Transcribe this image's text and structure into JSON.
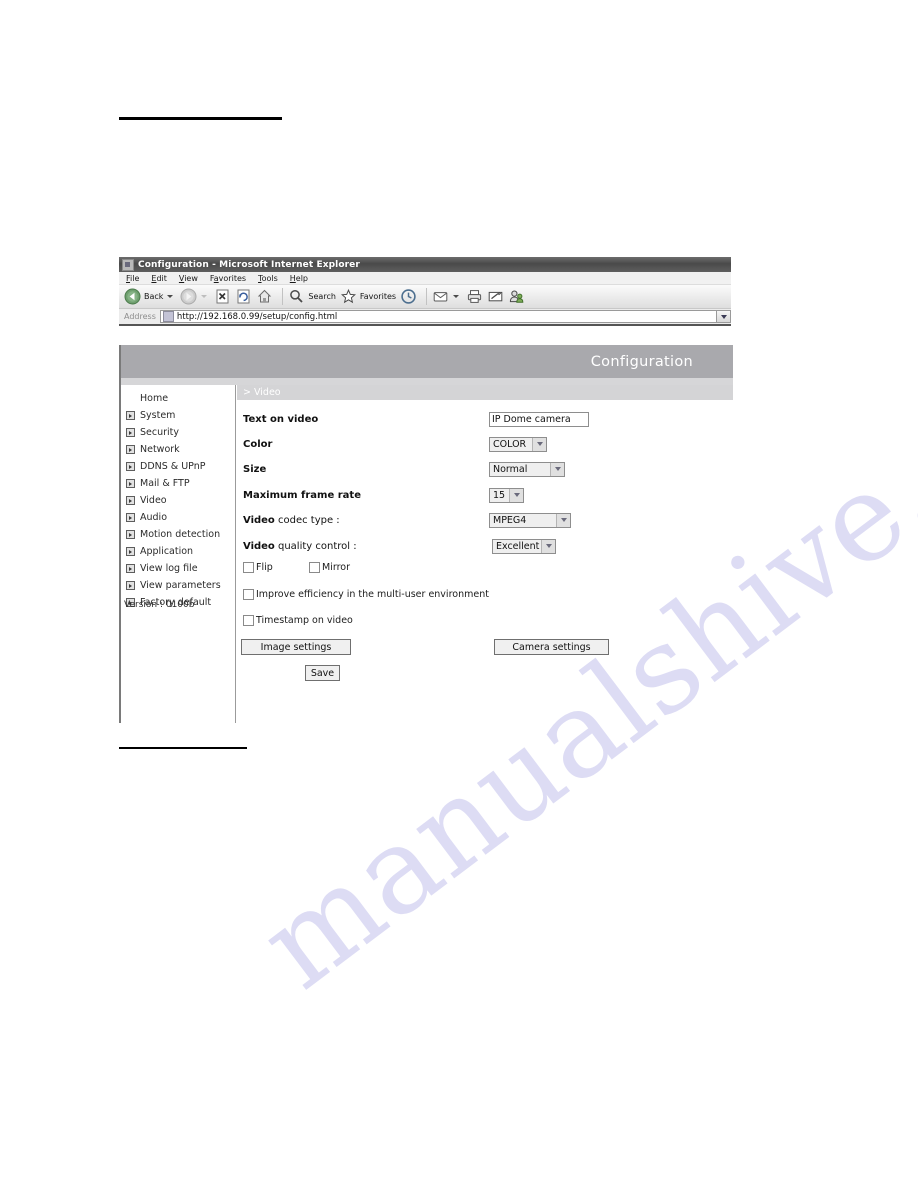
{
  "browser": {
    "title": "Configuration - Microsoft Internet Explorer",
    "menu": [
      {
        "pre": "",
        "acc": "F",
        "post": "ile"
      },
      {
        "pre": "",
        "acc": "E",
        "post": "dit"
      },
      {
        "pre": "",
        "acc": "V",
        "post": "iew"
      },
      {
        "pre": "F",
        "acc": "a",
        "post": "vorites"
      },
      {
        "pre": "",
        "acc": "T",
        "post": "ools"
      },
      {
        "pre": "",
        "acc": "H",
        "post": "elp"
      }
    ],
    "toolbar": {
      "back_label": "Back",
      "forward_label": "",
      "stop_name": "stop-icon",
      "refresh_name": "refresh-icon",
      "home_name": "home-icon",
      "search_label": "Search",
      "favorites_label": "Favorites",
      "history_name": "history-icon",
      "mail_name": "mail-icon",
      "print_name": "print-icon",
      "edit_name": "edit-icon",
      "messenger_name": "messenger-icon"
    },
    "address": {
      "label": "Address",
      "url": "http://192.168.0.99/setup/config.html"
    }
  },
  "page": {
    "banner_title": "Configuration",
    "section_title": "> Video",
    "version_text": "Version : 0100b",
    "sidebar": [
      {
        "label": "Home",
        "bullet": false
      },
      {
        "label": "System",
        "bullet": true
      },
      {
        "label": "Security",
        "bullet": true
      },
      {
        "label": "Network",
        "bullet": true
      },
      {
        "label": "DDNS & UPnP",
        "bullet": true
      },
      {
        "label": "Mail & FTP",
        "bullet": true
      },
      {
        "label": "Video",
        "bullet": true
      },
      {
        "label": "Audio",
        "bullet": true
      },
      {
        "label": "Motion detection",
        "bullet": true
      },
      {
        "label": "Application",
        "bullet": true
      },
      {
        "label": "View log file",
        "bullet": true
      },
      {
        "label": "View parameters",
        "bullet": true
      },
      {
        "label": "Factory default",
        "bullet": true
      }
    ],
    "fields": {
      "text_on_video_label": "Text on video",
      "text_on_video_value": "IP Dome camera",
      "color_label": "Color",
      "color_value": "COLOR",
      "size_label": "Size",
      "size_value": "Normal",
      "frame_rate_label": "Maximum frame rate",
      "frame_rate_value": "15",
      "codec_label_bold": "Video",
      "codec_label_rest": " codec type :",
      "codec_value": "MPEG4",
      "quality_label_bold": "Video",
      "quality_label_rest": " quality control :",
      "quality_value": "Excellent"
    },
    "checkboxes": {
      "flip": "Flip",
      "mirror": "Mirror",
      "improve_efficiency": "Improve efficiency in the multi-user environment",
      "timestamp": "Timestamp on video"
    },
    "buttons": {
      "image_settings": "Image settings",
      "camera_settings": "Camera settings",
      "save": "Save"
    }
  },
  "watermark": {
    "text": "manualshive.com"
  }
}
